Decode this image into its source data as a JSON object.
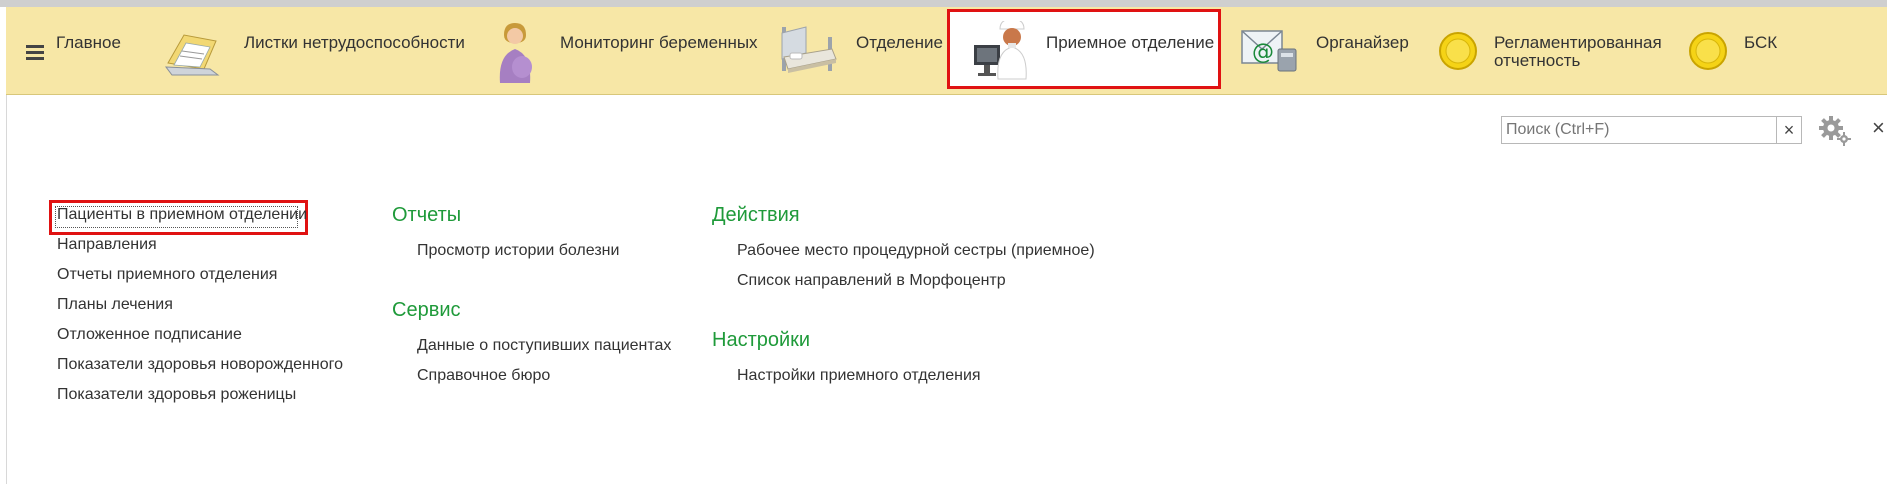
{
  "navbar": {
    "main_label": "Главное",
    "items": [
      {
        "label": "Листки нетрудоспособности",
        "icon": "sick-leave-folder-icon"
      },
      {
        "label": "Мониторинг беременных",
        "icon": "pregnant-woman-icon"
      },
      {
        "label": "Отделение",
        "icon": "hospital-bed-icon"
      },
      {
        "label": "Приемное отделение",
        "icon": "doctor-computer-icon"
      },
      {
        "label": "Органайзер",
        "icon": "email-phone-icon"
      },
      {
        "label": "Регламентированная отчетность",
        "icon": "yellow-circle-icon"
      },
      {
        "label": "БСК",
        "icon": "yellow-circle-icon"
      }
    ],
    "active": "Приемное отделение"
  },
  "search": {
    "placeholder": "Поиск (Ctrl+F)",
    "clear": "×"
  },
  "window": {
    "close": "×"
  },
  "left_links": [
    "Пациенты в приемном отделении",
    "Направления",
    "Отчеты приемного отделения",
    "Планы лечения",
    "Отложенное подписание",
    "Показатели здоровья новорожденного",
    "Показатели здоровья роженицы"
  ],
  "sections": {
    "reports": {
      "title": "Отчеты",
      "items": [
        "Просмотр истории болезни"
      ]
    },
    "service": {
      "title": "Сервис",
      "items": [
        "Данные о поступивших пациентах",
        "Справочное бюро"
      ]
    },
    "actions": {
      "title": "Действия",
      "items": [
        "Рабочее место процедурной сестры (приемное)",
        "Список направлений в Морфоцентр"
      ]
    },
    "settings": {
      "title": "Настройки",
      "items": [
        "Настройки приемного отделения"
      ]
    }
  },
  "colors": {
    "navbar_bg": "#f7e7a6",
    "section_title": "#1f9a3a",
    "highlight": "#e01212"
  }
}
